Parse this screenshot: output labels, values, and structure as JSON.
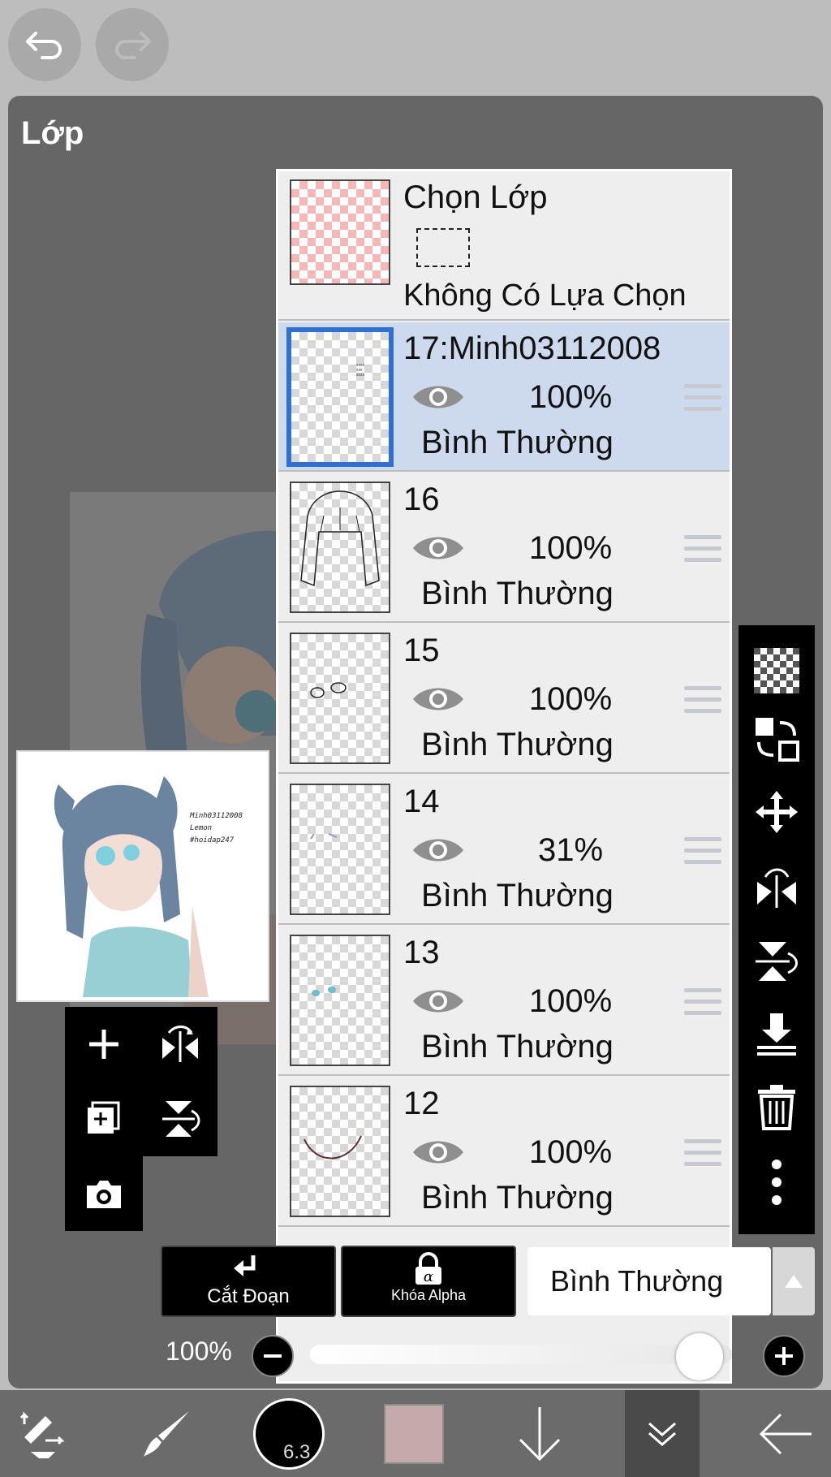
{
  "panel": {
    "title": "Lớp"
  },
  "selection": {
    "title": "Chọn Lớp",
    "status": "Không Có Lựa Chọn"
  },
  "layers": [
    {
      "name": "17:Minh03112008",
      "opacity": "100%",
      "blend": "Bình Thường",
      "selected": true
    },
    {
      "name": "16",
      "opacity": "100%",
      "blend": "Bình Thường",
      "selected": false
    },
    {
      "name": "15",
      "opacity": "100%",
      "blend": "Bình Thường",
      "selected": false
    },
    {
      "name": "14",
      "opacity": "31%",
      "blend": "Bình Thường",
      "selected": false
    },
    {
      "name": "13",
      "opacity": "100%",
      "blend": "Bình Thường",
      "selected": false
    },
    {
      "name": "12",
      "opacity": "100%",
      "blend": "Bình Thường",
      "selected": false
    }
  ],
  "preview": {
    "watermark_lines": [
      "Minh03112008",
      "Lemon",
      "#hoidap247"
    ]
  },
  "controls": {
    "clip_label": "Cắt Đoạn",
    "alpha_lock_label": "Khóa Alpha",
    "blend_mode": "Bình Thường",
    "opacity_label": "100%",
    "opacity_value": 1.0
  },
  "brush": {
    "size": "6.3"
  },
  "colors": {
    "accent": "#2f6fd6",
    "selected_row": "#cdd9ed",
    "current_color": "#c4aaa8"
  },
  "icons": {
    "undo": "undo-icon",
    "redo": "redo-icon",
    "add": "add-layer-icon",
    "duplicate": "duplicate-layer-icon",
    "camera": "camera-icon",
    "flip_h": "flip-horizontal-icon",
    "flip_v": "flip-vertical-icon",
    "transparency": "transparency-icon",
    "swap": "swap-icon",
    "move": "move-icon",
    "merge_down": "merge-down-icon",
    "delete": "trash-icon",
    "more": "more-vertical-icon"
  }
}
